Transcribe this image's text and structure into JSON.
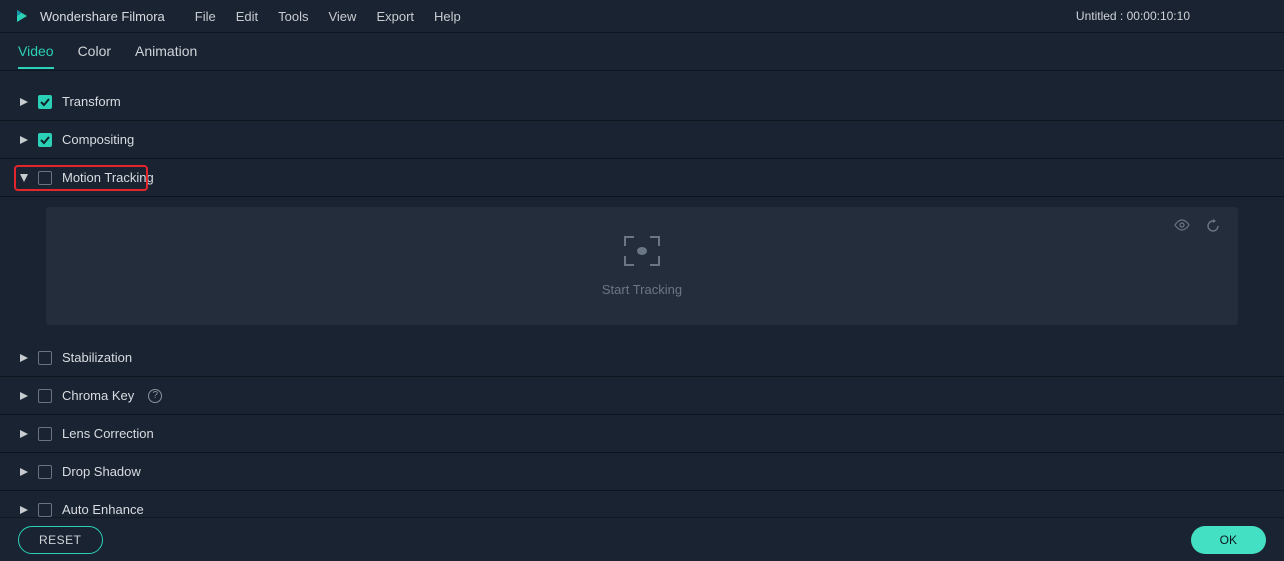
{
  "app_name": "Wondershare Filmora",
  "menu": [
    "File",
    "Edit",
    "Tools",
    "View",
    "Export",
    "Help"
  ],
  "project_title": "Untitled : 00:00:10:10",
  "tabs": [
    "Video",
    "Color",
    "Animation"
  ],
  "active_tab": "Video",
  "sections": [
    {
      "label": "Transform",
      "checked": true,
      "expanded": false,
      "has_help": false
    },
    {
      "label": "Compositing",
      "checked": true,
      "expanded": false,
      "has_help": false
    },
    {
      "label": "Motion Tracking",
      "checked": false,
      "expanded": true,
      "has_help": false,
      "highlighted": true
    },
    {
      "label": "Stabilization",
      "checked": false,
      "expanded": false,
      "has_help": false
    },
    {
      "label": "Chroma Key",
      "checked": false,
      "expanded": false,
      "has_help": true
    },
    {
      "label": "Lens Correction",
      "checked": false,
      "expanded": false,
      "has_help": false
    },
    {
      "label": "Drop Shadow",
      "checked": false,
      "expanded": false,
      "has_help": false
    },
    {
      "label": "Auto Enhance",
      "checked": false,
      "expanded": false,
      "has_help": false
    }
  ],
  "motion_tracking_panel": {
    "action_label": "Start Tracking"
  },
  "buttons": {
    "reset": "RESET",
    "ok": "OK"
  }
}
